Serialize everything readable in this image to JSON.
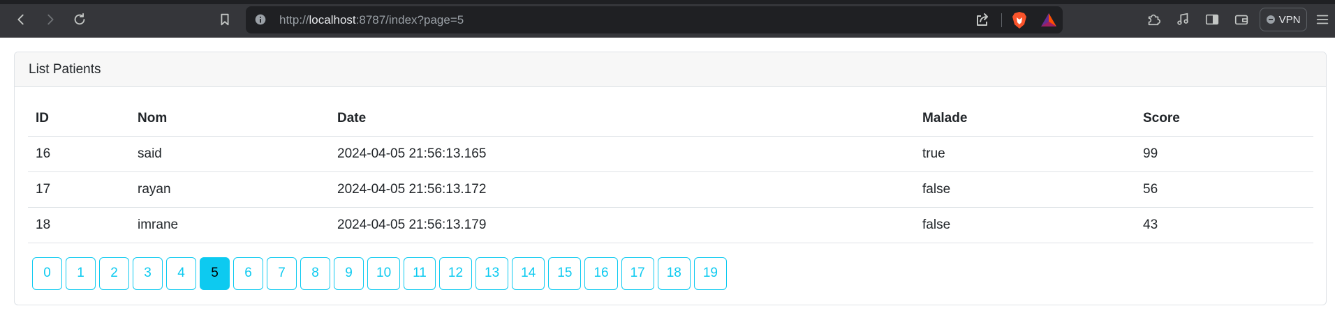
{
  "browser": {
    "url_scheme": "http://",
    "url_host": "localhost",
    "url_rest": ":8787/index?page=5",
    "vpn_label": "VPN",
    "icons": [
      "back-icon",
      "forward-icon",
      "reload-icon",
      "bookmark-icon",
      "site-info-icon",
      "share-icon",
      "brave-shield-icon",
      "brave-rewards-icon",
      "extensions-icon",
      "media-icon",
      "sidebar-icon",
      "wallet-icon",
      "menu-icon"
    ]
  },
  "card": {
    "title": "List Patients"
  },
  "table": {
    "headers": {
      "id": "ID",
      "nom": "Nom",
      "date": "Date",
      "malade": "Malade",
      "score": "Score"
    },
    "rows": [
      {
        "id": "16",
        "nom": "said",
        "date": "2024-04-05 21:56:13.165",
        "malade": "true",
        "score": "99"
      },
      {
        "id": "17",
        "nom": "rayan",
        "date": "2024-04-05 21:56:13.172",
        "malade": "false",
        "score": "56"
      },
      {
        "id": "18",
        "nom": "imrane",
        "date": "2024-04-05 21:56:13.179",
        "malade": "false",
        "score": "43"
      }
    ]
  },
  "pagination": {
    "pages": [
      "0",
      "1",
      "2",
      "3",
      "4",
      "5",
      "6",
      "7",
      "8",
      "9",
      "10",
      "11",
      "12",
      "13",
      "14",
      "15",
      "16",
      "17",
      "18",
      "19"
    ],
    "current": "5"
  },
  "colors": {
    "accent": "#0dcaf0",
    "chrome_bg": "#35363a",
    "url_bg": "#1f2023"
  }
}
